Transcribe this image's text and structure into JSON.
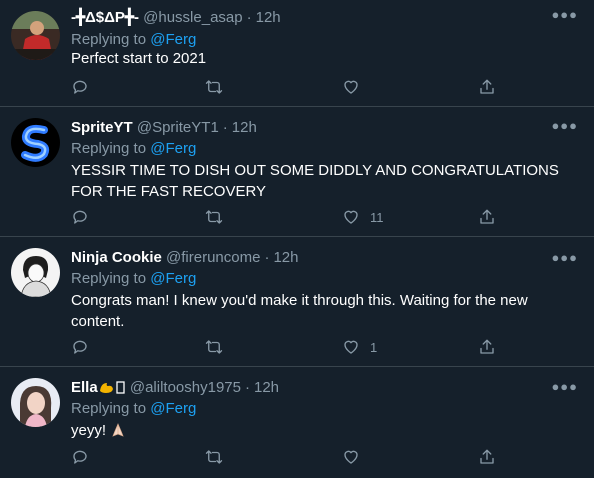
{
  "tweets": [
    {
      "name": "-╋Δ$ΔP╋-",
      "handle": "@hussle_asap",
      "time": "12h",
      "replying_prefix": "Replying to",
      "replying_to": "@Ferg",
      "text": "Perfect start to 2021",
      "likes": ""
    },
    {
      "name": "SpriteYT",
      "handle": "@SpriteYT1",
      "time": "12h",
      "replying_prefix": "Replying to",
      "replying_to": "@Ferg",
      "text": "YESSIR TIME TO DISH OUT SOME DIDDLY AND CONGRATULATIONS FOR THE FAST RECOVERY",
      "likes": "11"
    },
    {
      "name": "Ninja Cookie",
      "handle": "@fireruncome",
      "time": "12h",
      "replying_prefix": "Replying to",
      "replying_to": "@Ferg",
      "text": "Congrats man! I knew you'd make it through this. Waiting for the new content.",
      "likes": "1"
    },
    {
      "name": "Ella",
      "handle": "@aliltooshy1975",
      "time": "12h",
      "replying_prefix": "Replying to",
      "replying_to": "@Ferg",
      "text": "yeyy!",
      "likes": ""
    }
  ],
  "icons": {
    "reply": "reply-icon",
    "retweet": "retweet-icon",
    "like": "heart-icon",
    "share": "share-icon",
    "more": "more-icon"
  },
  "colors": {
    "background": "#15202b",
    "divider": "#38444d",
    "muted": "#8899a6",
    "link": "#1da1f2",
    "text": "#ffffff"
  }
}
